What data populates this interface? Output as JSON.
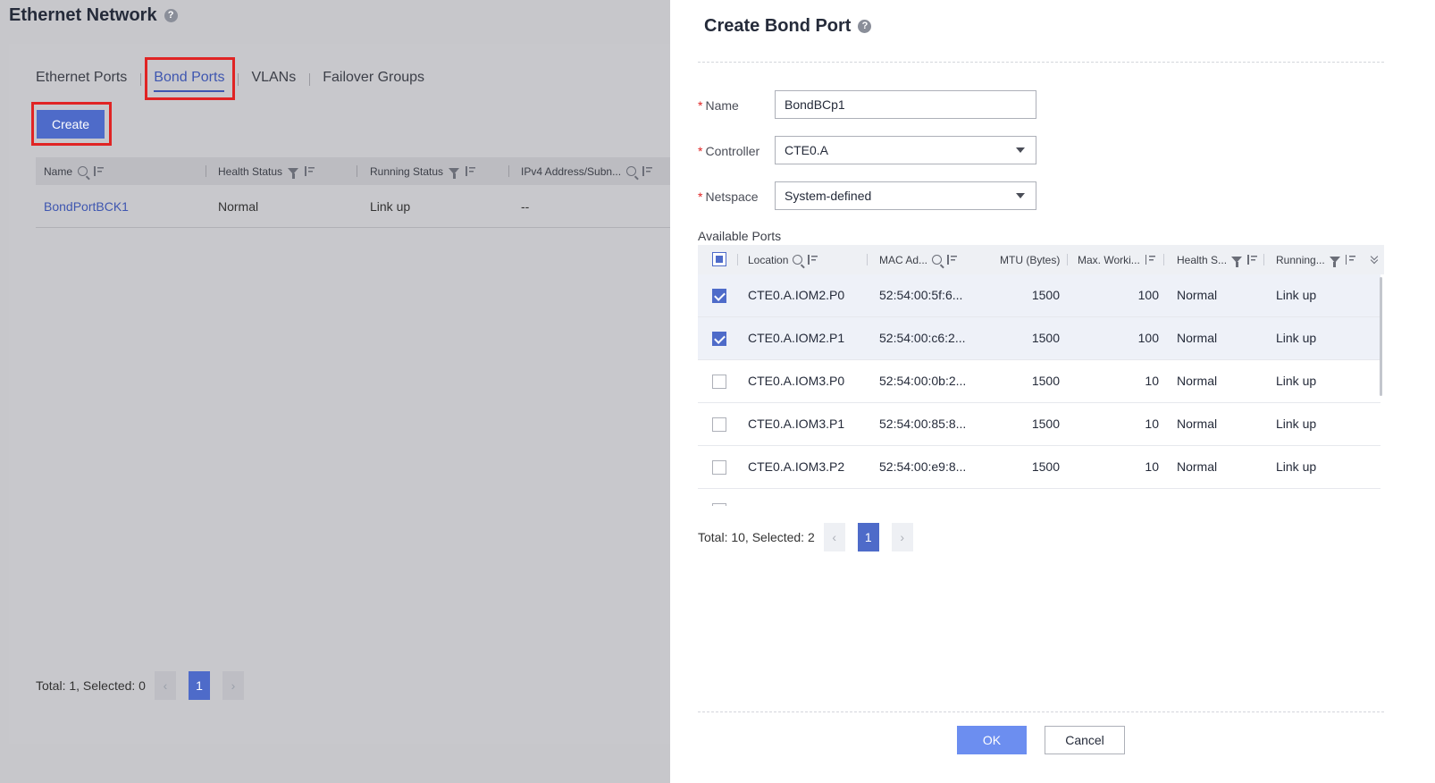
{
  "page": {
    "title": "Ethernet Network",
    "tabs": [
      {
        "label": "Ethernet Ports",
        "active": false
      },
      {
        "label": "Bond Ports",
        "active": true
      },
      {
        "label": "VLANs",
        "active": false
      },
      {
        "label": "Failover Groups",
        "active": false
      }
    ],
    "create_label": "Create",
    "table": {
      "columns": [
        "Name",
        "Health Status",
        "Running Status",
        "IPv4 Address/Subn..."
      ],
      "rows": [
        {
          "name": "BondPortBCK1",
          "health": "Normal",
          "running": "Link up",
          "ipv4": "--"
        }
      ]
    },
    "pager": {
      "summary": "Total: 1, Selected: 0",
      "page": "1",
      "prev": "‹",
      "next": "›"
    }
  },
  "drawer": {
    "title": "Create Bond Port",
    "fields": {
      "name_label": "Name",
      "name_value": "BondBCp1",
      "controller_label": "Controller",
      "controller_value": "CTE0.A",
      "netspace_label": "Netspace",
      "netspace_value": "System-defined",
      "required_mark": "*"
    },
    "available_ports_label": "Available Ports",
    "ports": {
      "columns": [
        "Location",
        "MAC Ad...",
        "MTU (Bytes)",
        "Max. Worki...",
        "Health S...",
        "Running..."
      ],
      "rows": [
        {
          "checked": true,
          "location": "CTE0.A.IOM2.P0",
          "mac": "52:54:00:5f:6...",
          "mtu": "1500",
          "max": "100",
          "health": "Normal",
          "running": "Link up"
        },
        {
          "checked": true,
          "location": "CTE0.A.IOM2.P1",
          "mac": "52:54:00:c6:2...",
          "mtu": "1500",
          "max": "100",
          "health": "Normal",
          "running": "Link up"
        },
        {
          "checked": false,
          "location": "CTE0.A.IOM3.P0",
          "mac": "52:54:00:0b:2...",
          "mtu": "1500",
          "max": "10",
          "health": "Normal",
          "running": "Link up"
        },
        {
          "checked": false,
          "location": "CTE0.A.IOM3.P1",
          "mac": "52:54:00:85:8...",
          "mtu": "1500",
          "max": "10",
          "health": "Normal",
          "running": "Link up"
        },
        {
          "checked": false,
          "location": "CTE0.A.IOM3.P2",
          "mac": "52:54:00:e9:8...",
          "mtu": "1500",
          "max": "10",
          "health": "Normal",
          "running": "Link up"
        }
      ]
    },
    "pager": {
      "summary": "Total: 10, Selected: 2",
      "page": "1",
      "prev": "‹",
      "next": "›"
    },
    "ok_label": "OK",
    "cancel_label": "Cancel"
  },
  "icons": {
    "help": "?"
  },
  "colors": {
    "accent": "#4e6bc9",
    "highlight": "#e02424",
    "ok": "#6c8ef0"
  }
}
